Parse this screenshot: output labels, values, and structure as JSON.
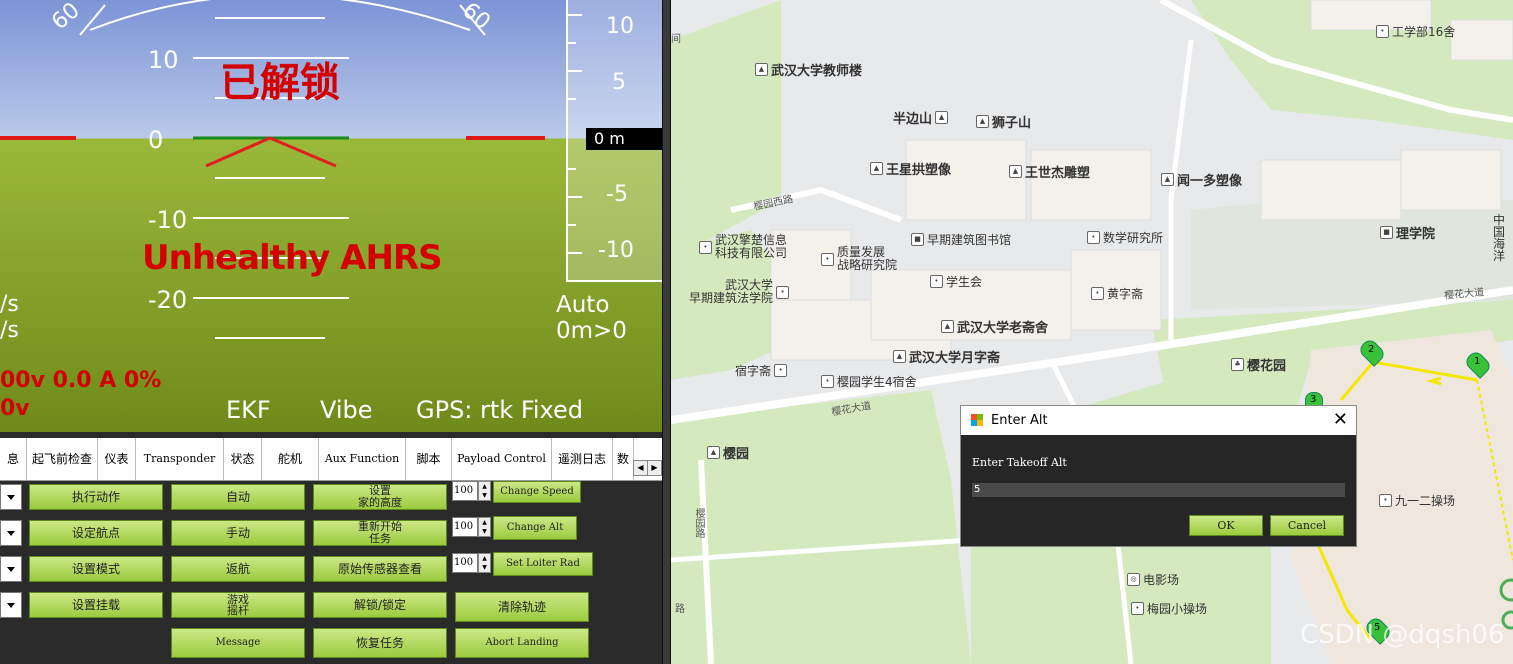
{
  "hud": {
    "pitch_labels": {
      "p10": "10",
      "p0": "0",
      "m10": "-10",
      "m20": "-20"
    },
    "roll_labels": {
      "left": "60",
      "right": "60"
    },
    "armed": "已解锁",
    "warning": "Unhealthy AHRS",
    "alt_scale": {
      "a10": "10",
      "a5": "5",
      "m5": "-5",
      "m10": "-10"
    },
    "altitude": "0 m",
    "speed_unit_1": "/s",
    "speed_unit_2": "/s",
    "mode": "Auto",
    "wp_info": "0m>0",
    "battery_1": "00v 0.0 A 0%",
    "battery_2": "0v",
    "ekf": "EKF",
    "vibe": "Vibe",
    "gps": "GPS: rtk Fixed"
  },
  "tabs": [
    "息",
    "起飞前检查",
    "仪表",
    "Transponder",
    "状态",
    "舵机",
    "Aux Function",
    "脚本",
    "Payload Control",
    "遥测日志",
    "数"
  ],
  "actions": {
    "col1": [
      "执行动作",
      "设定航点",
      "设置模式",
      "设置挂载"
    ],
    "col2": [
      "自动",
      "手动",
      "返航",
      "游戏\n摇杆",
      "Message"
    ],
    "col3": [
      "设置\n家的高度",
      "重新开始\n任务",
      "原始传感器查看",
      "解锁/锁定",
      "恢复任务"
    ],
    "col4_inputs": [
      "100",
      "100",
      "100"
    ],
    "col4_buttons": [
      "Change Speed",
      "Change Alt",
      "Set Loiter Rad"
    ],
    "col4_extra": [
      "清除轨迹",
      "Abort Landing"
    ]
  },
  "map": {
    "pois": [
      "武汉大学教师楼",
      "半边山",
      "狮子山",
      "王星拱塑像",
      "王世杰雕塑",
      "闻一多塑像",
      "工学部16舍",
      "理学院",
      "武汉擎楚信息\n科技有限公司",
      "质量发展\n战略研究院",
      "早期建筑图书馆",
      "数学研究所",
      "学生会",
      "武汉大学\n早期建筑法学院",
      "黄字斋",
      "武汉大学老斋舍",
      "武汉大学月字斋",
      "樱花园",
      "宿字斋",
      "樱园学生4宿舍",
      "樱园",
      "九一二操场",
      "电影场",
      "梅园小操场",
      "中国\n海洋"
    ],
    "roads": [
      "樱园西路",
      "樱花大道",
      "樱花大道",
      "樱园路",
      "路"
    ],
    "waypoints": [
      "1",
      "2",
      "3",
      "5"
    ],
    "edge_text": "间"
  },
  "dialog": {
    "title": "Enter Alt",
    "label": "Enter Takeoff Alt",
    "value": "5",
    "ok": "OK",
    "cancel": "Cancel"
  },
  "watermark": "CSDN @dqsh06",
  "colors": {
    "button_green": "#9bcb3e",
    "armed_red": "#d40000",
    "route_yellow": "#f5e800"
  }
}
